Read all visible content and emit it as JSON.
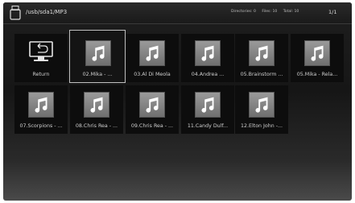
{
  "header": {
    "path": "/usb/sda1/MP3",
    "directories": "Directories: 0",
    "files": "Files: 10",
    "total": "Total: 10",
    "page": "1/1"
  },
  "items": [
    {
      "label": "Return",
      "icon": "return-icon"
    },
    {
      "label": "02.Mika - ...",
      "icon": "music-note-icon"
    },
    {
      "label": "03.Al Di Meola",
      "icon": "music-note-icon"
    },
    {
      "label": "04.Andrea ...",
      "icon": "music-note-icon"
    },
    {
      "label": "05.Brainstorm ...",
      "icon": "music-note-icon"
    },
    {
      "label": "05.Mika - Rela...",
      "icon": "music-note-icon"
    },
    {
      "label": "07.Scorpions - ...",
      "icon": "music-note-icon"
    },
    {
      "label": "08.Chris Rea - ...",
      "icon": "music-note-icon"
    },
    {
      "label": "09.Chris Rea - ...",
      "icon": "music-note-icon"
    },
    {
      "label": "11.Candy Dulf...",
      "icon": "music-note-icon"
    },
    {
      "label": "12.Elton John -...",
      "icon": "music-note-icon"
    }
  ],
  "selected_index": 1,
  "colors": {
    "background": "#161616",
    "tile": "#0d0d0d",
    "selection_border": "#bfbfbf",
    "thumbnail": "#8a8a8a"
  }
}
